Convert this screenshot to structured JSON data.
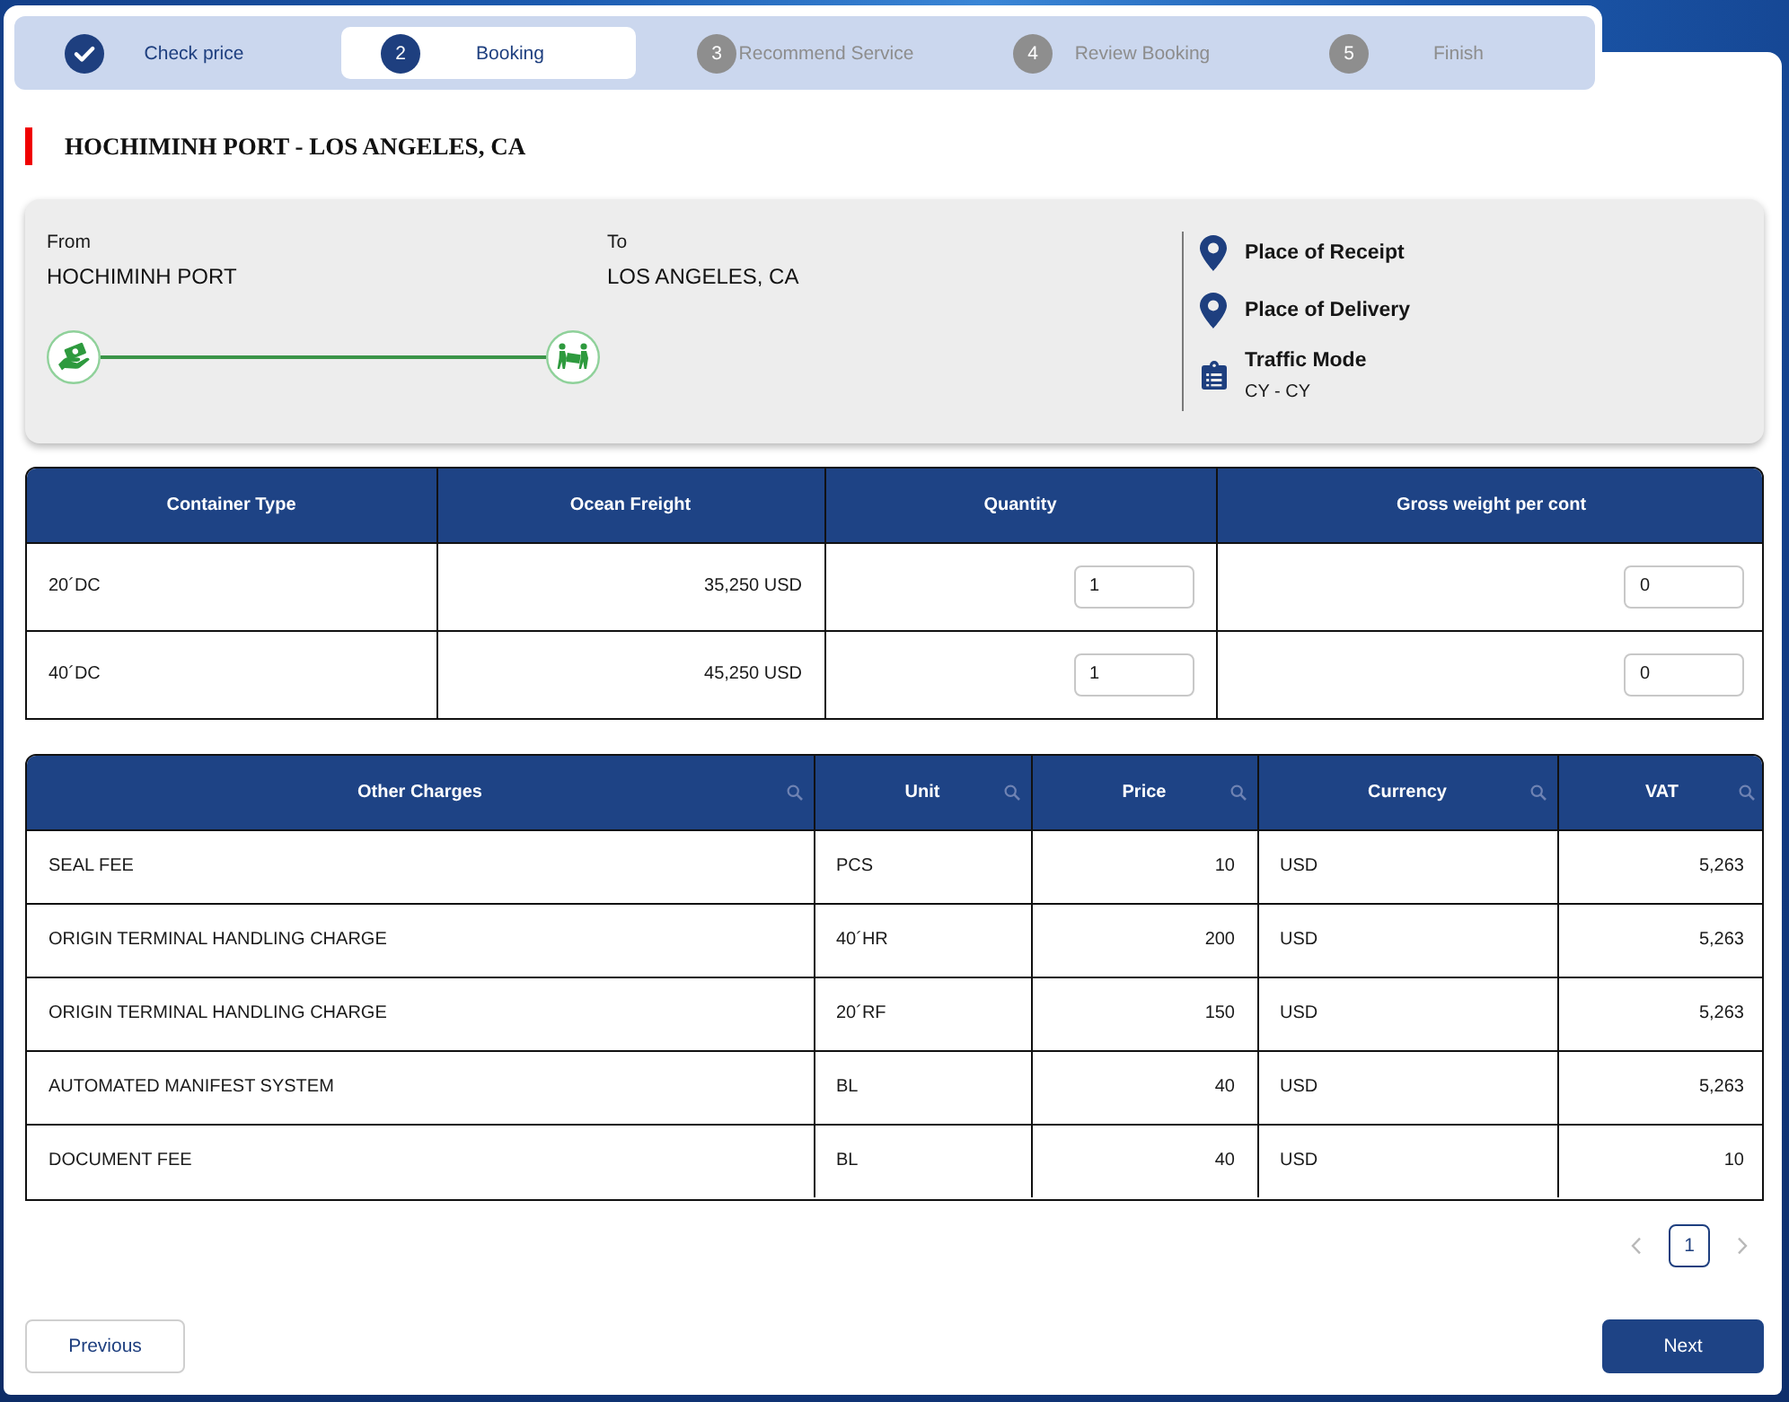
{
  "stepper": {
    "steps": [
      {
        "label": "Check price",
        "completed": true,
        "selected": false
      },
      {
        "number": "2",
        "label": "Booking",
        "completed": false,
        "selected": true
      },
      {
        "number": "3",
        "label": "Recommend Service",
        "completed": false,
        "selected": false
      },
      {
        "number": "4",
        "label": "Review Booking",
        "completed": false,
        "selected": false
      },
      {
        "number": "5",
        "label": "Finish",
        "completed": false,
        "selected": false
      }
    ]
  },
  "route_title": "HOCHIMINH PORT - LOS ANGELES, CA",
  "route": {
    "from": {
      "label": "From",
      "value": "HOCHIMINH PORT"
    },
    "to": {
      "label": "To",
      "value": "LOS ANGELES, CA"
    },
    "details": [
      {
        "kind": "place",
        "label": "Place of Receipt"
      },
      {
        "kind": "place",
        "label": "Place of Delivery"
      },
      {
        "kind": "mode",
        "label": "Traffic Mode",
        "value": "CY - CY"
      }
    ]
  },
  "container_table": {
    "columns": [
      "Container Type",
      "Ocean Freight",
      "Quantity",
      "Gross weight per cont"
    ],
    "rows": [
      {
        "container_type": "20´DC",
        "ocean_freight": "35,250 USD",
        "quantity": "1",
        "gross_weight": "0"
      },
      {
        "container_type": "40´DC",
        "ocean_freight": "45,250 USD",
        "quantity": "1",
        "gross_weight": "0"
      }
    ]
  },
  "charges_table": {
    "columns": [
      "Other Charges",
      "Unit",
      "Price",
      "Currency",
      "VAT"
    ],
    "rows": [
      {
        "charge": "SEAL FEE",
        "unit": "PCS",
        "price": "10",
        "currency": "USD",
        "vat": "5,263"
      },
      {
        "charge": "ORIGIN TERMINAL HANDLING CHARGE",
        "unit": "40´HR",
        "price": "200",
        "currency": "USD",
        "vat": "5,263"
      },
      {
        "charge": "ORIGIN TERMINAL HANDLING CHARGE",
        "unit": "20´RF",
        "price": "150",
        "currency": "USD",
        "vat": "5,263"
      },
      {
        "charge": "AUTOMATED MANIFEST SYSTEM",
        "unit": "BL",
        "price": "40",
        "currency": "USD",
        "vat": "5,263"
      },
      {
        "charge": "DOCUMENT FEE",
        "unit": "BL",
        "price": "40",
        "currency": "USD",
        "vat": "10"
      }
    ]
  },
  "pagination": {
    "previous": {
      "disabled": true
    },
    "pages": [
      {
        "label": "1",
        "selected": true
      }
    ],
    "next": {
      "disabled": true
    }
  },
  "buttons": [
    {
      "kind": "secondary",
      "label": "Previous"
    },
    {
      "kind": "primary",
      "label": "Next"
    }
  ]
}
